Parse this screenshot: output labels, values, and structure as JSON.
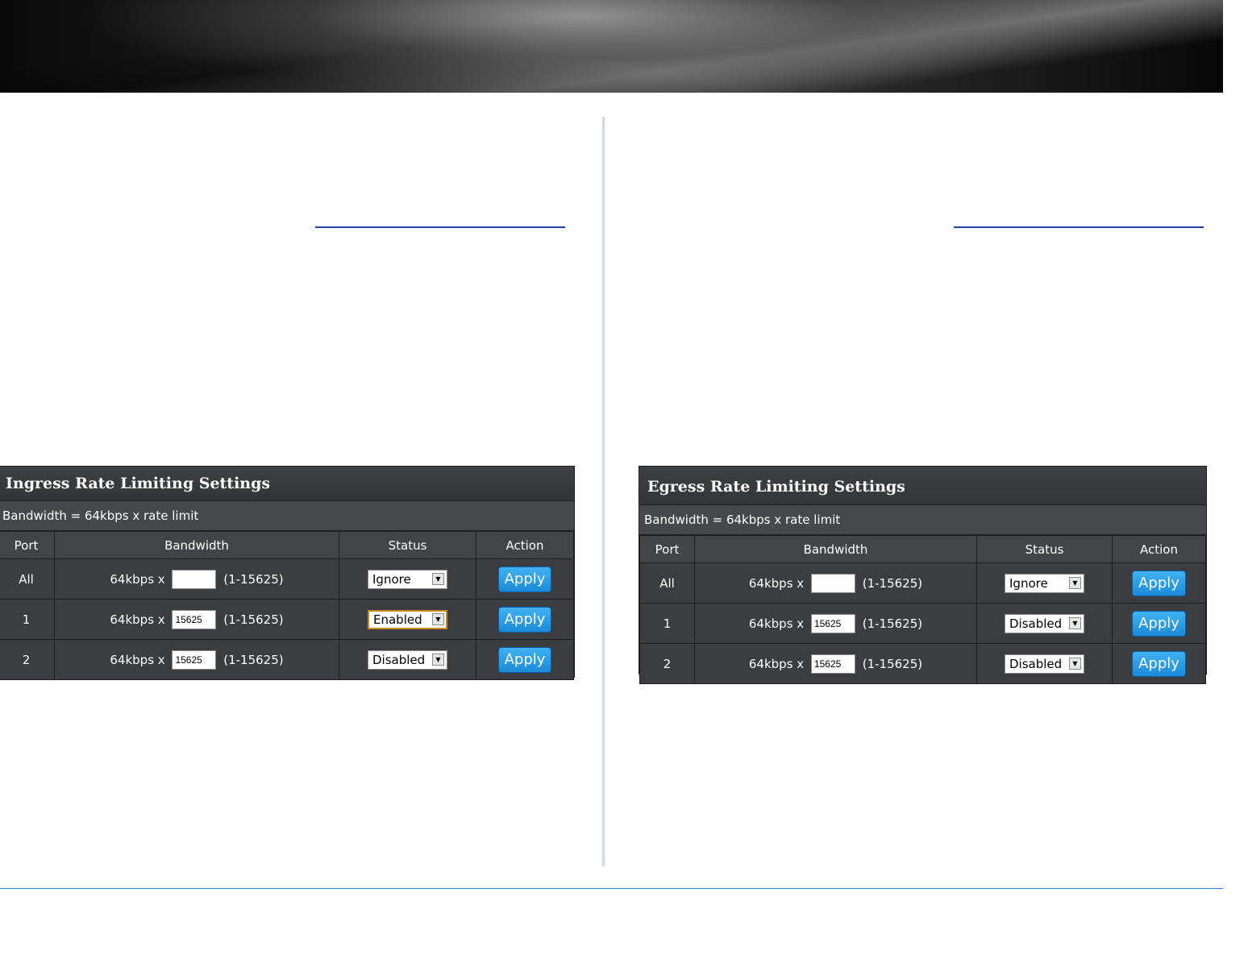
{
  "ingress": {
    "title": "Ingress Rate Limiting Settings",
    "formula": "Bandwidth = 64kbps x rate limit",
    "headers": [
      "Port",
      "Bandwidth",
      "Status",
      "Action"
    ],
    "rows": [
      {
        "port": "All",
        "prefix": "64kbps x",
        "value": "",
        "range": "(1-15625)",
        "status": "Ignore",
        "action": "Apply"
      },
      {
        "port": "1",
        "prefix": "64kbps x",
        "value": "15625",
        "range": "(1-15625)",
        "status": "Enabled",
        "action": "Apply"
      },
      {
        "port": "2",
        "prefix": "64kbps x",
        "value": "15625",
        "range": "(1-15625)",
        "status": "Disabled",
        "action": "Apply"
      }
    ]
  },
  "egress": {
    "title": "Egress Rate Limiting Settings",
    "formula": "Bandwidth = 64kbps x rate limit",
    "headers": [
      "Port",
      "Bandwidth",
      "Status",
      "Action"
    ],
    "rows": [
      {
        "port": "All",
        "prefix": "64kbps x",
        "value": "",
        "range": "(1-15625)",
        "status": "Ignore",
        "action": "Apply"
      },
      {
        "port": "1",
        "prefix": "64kbps x",
        "value": "15625",
        "range": "(1-15625)",
        "status": "Disabled",
        "action": "Apply"
      },
      {
        "port": "2",
        "prefix": "64kbps x",
        "value": "15625",
        "range": "(1-15625)",
        "status": "Disabled",
        "action": "Apply"
      }
    ]
  },
  "icons": {
    "dropdown": "chevron-down-icon"
  }
}
